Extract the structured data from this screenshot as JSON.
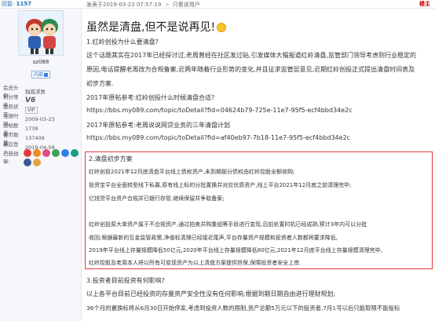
{
  "topbar": {
    "reply_label": "回复:",
    "reply_count": "1157",
    "post_time": "发表于2019-03-23 07:57:19",
    "view_author": "只看该用户",
    "floor": "楼主"
  },
  "user": {
    "name": "sz088",
    "level": "内部",
    "fields": [
      {
        "key": "会员头衔:",
        "value": "独孤求败"
      },
      {
        "key": "积分等级:",
        "value": "V6"
      },
      {
        "key": "会员状态:",
        "value": "VIP"
      },
      {
        "key": "注册时间:",
        "value": "2009-03-23"
      },
      {
        "key": "发帖数量:",
        "value": "1739"
      },
      {
        "key": "金币数量:",
        "value": "137409"
      },
      {
        "key": "最后登入:",
        "value": "2019-04-08"
      },
      {
        "key": "已获勋章:",
        "value": ""
      }
    ],
    "medal_colors": [
      "#e23a3a",
      "#f08a24",
      "#e24a8a",
      "#3aa35a",
      "#2f80ed",
      "#16a085",
      "#3b5998",
      "#e6a23c"
    ]
  },
  "post": {
    "title": "虽然是清盘,但不是说再见!",
    "lines": [
      "1.红岭创投为什么要清盘?",
      "这个话题其实在2017年已经探讨过,老周曾经在社区发过贴,引发媒体大幅报道红岭清盘,监管部门领导考虑到行业稳定的",
      "原因,电话提醒老周改为合规备案,近两年随着行业形势的变化,并且征求监管层意见,近期红岭创投正式提出清盘时间表及",
      "初步方案.",
      "2017年原帖参考:红岭创投什么时候清盘合适?",
      "https://bbs.my089.com/topic/toDetail?fid=04624b79-725e-11e7-95f5-ecf4bbd34e2c",
      "2017年原帖参考:老周说说网贷业务的三年清盘计划",
      "https://bbs.my089.com/topic/toDetail?fid=af40eb97-7b18-11e7-95f5-ecf4bbd34e2c"
    ],
    "plan": [
      "2.清盘初步方案",
      "红岭创投2021年12月底清盘平台线上债权资产,未到期部分债权由红岭控股全额收购;",
      "投资宝平台全面转型线下私募,原有线上标的分批置换并对应优质资产,线上平台2021年12月底之前清理完毕;",
      "亿钱贷平台资产合规并已银行存管,继续保留并争取备案;",
      "",
      "红岭创投原大单资产属于不合规资产,通过拍卖并购重组等手段进行变现,目前处置时机已经成熟,预计3年内可以分批",
      "收回;根据最新的互金监管政策,净值标清理已经接近尾声,平台存量资产规模和投资者人数都将要求降低,",
      "2019年平台线上存量规模降低50亿元,2020年平台线上存量规模降低80亿元,2021年12月底平台线上存量规模清理完毕,",
      "红岭控股及老周本人将以所有可变现资产为以上清盘方案提供担保,保障投资者安全上岸."
    ],
    "after": [
      "3.投资者目前投资有何影响?",
      "以上各平台目前已经投资的存量资产安全性没有任何影响,根据到期日期自由进行理财规划;",
      "36个月的置换标将从6月30日开始停发,考虑到投资人数的限制,资产总额5万元以下的投资者,7月1号以后只能取限不能投标"
    ]
  }
}
